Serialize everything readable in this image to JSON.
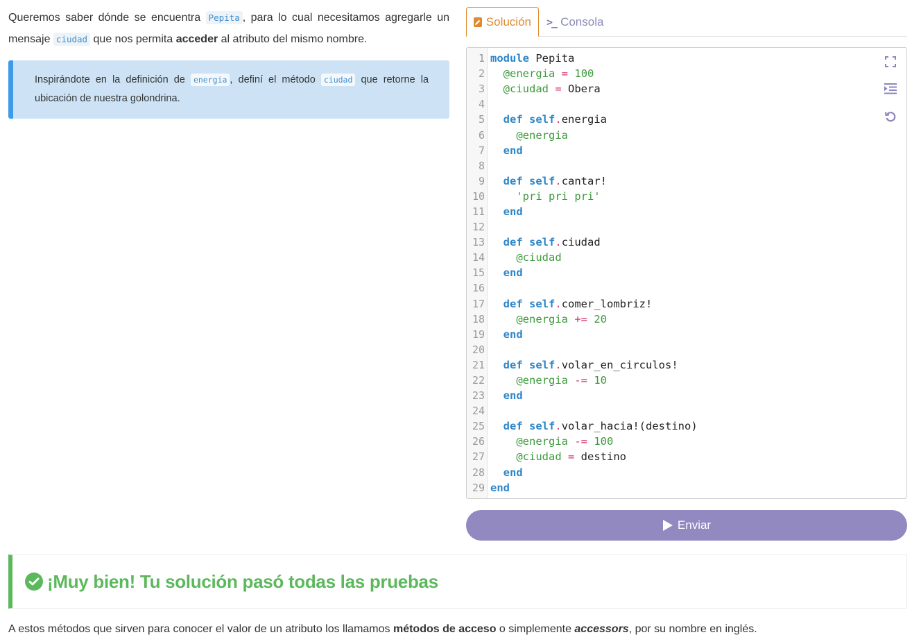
{
  "instructions": {
    "p1_a": "Queremos saber dónde se encuentra ",
    "p1_code1": "Pepita",
    "p1_b": ", para lo cual necesitamos agregarle un mensaje ",
    "p1_code2": "ciudad",
    "p1_c": " que nos permita ",
    "p1_bold": "acceder",
    "p1_d": " al atributo del mismo nombre."
  },
  "tip": {
    "a": "Inspirándote en la definición de ",
    "code1": "energia",
    "b": ", definí el método ",
    "code2": "ciudad",
    "c": " que retorne la ubicación de nuestra golondrina."
  },
  "tabs": {
    "solution": "Solución",
    "console": "Consola"
  },
  "editor": {
    "lines": [
      [
        [
          "kw",
          "module"
        ],
        [
          "t",
          " Pepita"
        ]
      ],
      [
        [
          "t",
          "  "
        ],
        [
          "iv",
          "@energia"
        ],
        [
          "t",
          " "
        ],
        [
          "op",
          "="
        ],
        [
          "t",
          " "
        ],
        [
          "num",
          "100"
        ]
      ],
      [
        [
          "t",
          "  "
        ],
        [
          "iv",
          "@ciudad"
        ],
        [
          "t",
          " "
        ],
        [
          "op",
          "="
        ],
        [
          "t",
          " Obera"
        ]
      ],
      [],
      [
        [
          "t",
          "  "
        ],
        [
          "kw",
          "def"
        ],
        [
          "t",
          " "
        ],
        [
          "kw",
          "self"
        ],
        [
          "op",
          "."
        ],
        [
          "t",
          "energia"
        ]
      ],
      [
        [
          "t",
          "    "
        ],
        [
          "iv",
          "@energia"
        ]
      ],
      [
        [
          "t",
          "  "
        ],
        [
          "kw",
          "end"
        ]
      ],
      [],
      [
        [
          "t",
          "  "
        ],
        [
          "kw",
          "def"
        ],
        [
          "t",
          " "
        ],
        [
          "kw",
          "self"
        ],
        [
          "op",
          "."
        ],
        [
          "t",
          "cantar!"
        ]
      ],
      [
        [
          "t",
          "    "
        ],
        [
          "str",
          "'pri pri pri'"
        ]
      ],
      [
        [
          "t",
          "  "
        ],
        [
          "kw",
          "end"
        ]
      ],
      [],
      [
        [
          "t",
          "  "
        ],
        [
          "kw",
          "def"
        ],
        [
          "t",
          " "
        ],
        [
          "kw",
          "self"
        ],
        [
          "op",
          "."
        ],
        [
          "t",
          "ciudad"
        ]
      ],
      [
        [
          "t",
          "    "
        ],
        [
          "iv",
          "@ciudad"
        ]
      ],
      [
        [
          "t",
          "  "
        ],
        [
          "kw",
          "end"
        ]
      ],
      [],
      [
        [
          "t",
          "  "
        ],
        [
          "kw",
          "def"
        ],
        [
          "t",
          " "
        ],
        [
          "kw",
          "self"
        ],
        [
          "op",
          "."
        ],
        [
          "t",
          "comer_lombriz!"
        ]
      ],
      [
        [
          "t",
          "    "
        ],
        [
          "iv",
          "@energia"
        ],
        [
          "t",
          " "
        ],
        [
          "op",
          "+="
        ],
        [
          "t",
          " "
        ],
        [
          "num",
          "20"
        ]
      ],
      [
        [
          "t",
          "  "
        ],
        [
          "kw",
          "end"
        ]
      ],
      [],
      [
        [
          "t",
          "  "
        ],
        [
          "kw",
          "def"
        ],
        [
          "t",
          " "
        ],
        [
          "kw",
          "self"
        ],
        [
          "op",
          "."
        ],
        [
          "t",
          "volar_en_circulos!"
        ]
      ],
      [
        [
          "t",
          "    "
        ],
        [
          "iv",
          "@energia"
        ],
        [
          "t",
          " "
        ],
        [
          "op",
          "-="
        ],
        [
          "t",
          " "
        ],
        [
          "num",
          "10"
        ]
      ],
      [
        [
          "t",
          "  "
        ],
        [
          "kw",
          "end"
        ]
      ],
      [],
      [
        [
          "t",
          "  "
        ],
        [
          "kw",
          "def"
        ],
        [
          "t",
          " "
        ],
        [
          "kw",
          "self"
        ],
        [
          "op",
          "."
        ],
        [
          "t",
          "volar_hacia!(destino)"
        ]
      ],
      [
        [
          "t",
          "    "
        ],
        [
          "iv",
          "@energia"
        ],
        [
          "t",
          " "
        ],
        [
          "op",
          "-="
        ],
        [
          "t",
          " "
        ],
        [
          "num",
          "100"
        ]
      ],
      [
        [
          "t",
          "    "
        ],
        [
          "iv",
          "@ciudad"
        ],
        [
          "t",
          " "
        ],
        [
          "op",
          "="
        ],
        [
          "t",
          " destino"
        ]
      ],
      [
        [
          "t",
          "  "
        ],
        [
          "kw",
          "end"
        ]
      ],
      [
        [
          "kw",
          "end"
        ]
      ]
    ],
    "tools": [
      "fullscreen-icon",
      "format-indent-icon",
      "reset-icon"
    ]
  },
  "submit": {
    "label": "Enviar",
    "color": "#9189c0"
  },
  "result": {
    "message": "¡Muy bien! Tu solución pasó todas las pruebas",
    "color": "#5cb85c"
  },
  "outro": {
    "a": "A estos métodos que sirven para conocer el valor de un atributo los llamamos ",
    "bold": "métodos de acceso",
    "b": " o simplemente ",
    "em": "accessors",
    "c": ", por su nombre en inglés."
  }
}
